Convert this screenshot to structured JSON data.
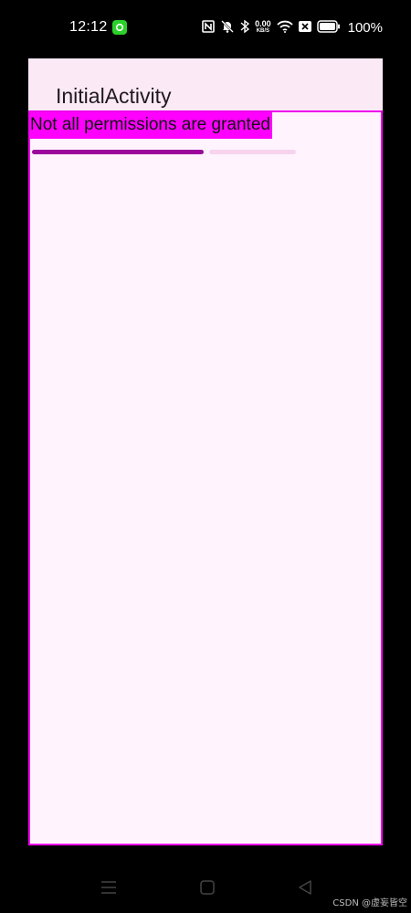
{
  "status_bar": {
    "time": "12:12",
    "net_speed_value": "0.00",
    "net_speed_unit": "KB/S",
    "battery": "100%",
    "icons": [
      "recording-app-icon",
      "nfc-icon",
      "mute-icon",
      "bluetooth-icon",
      "wifi-icon",
      "sim-off-icon",
      "battery-icon"
    ]
  },
  "app_bar": {
    "title": "InitialActivity"
  },
  "content": {
    "message": "Not all permissions are granted",
    "progress": 0.65
  },
  "nav_bar": {
    "icons": [
      "menu-icon",
      "home-icon",
      "back-icon"
    ]
  },
  "watermark": "CSDN @虚妄皆空",
  "colors": {
    "accent": "#ff00ff",
    "progress": "#9c089c",
    "progress_track": "#f7d3ee",
    "app_bar": "#fbe9f6",
    "background": "#fff4fe"
  }
}
